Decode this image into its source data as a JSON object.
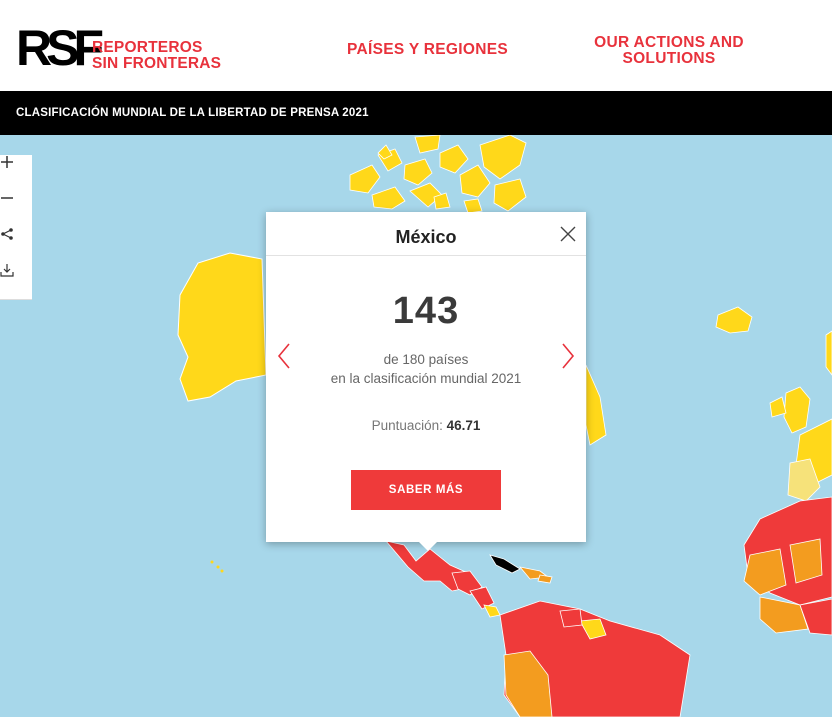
{
  "header": {
    "logo_mark": "RSF",
    "logo_line1": "REPORTEROS",
    "logo_line2": "SIN FRONTERAS",
    "nav": [
      "PAÍSES Y REGIONES",
      "OUR ACTIONS AND SOLUTIONS"
    ]
  },
  "titlebar": {
    "title": "CLASIFICACIÓN MUNDIAL DE LA LIBERTAD DE PRENSA 2021"
  },
  "controls": [
    "zoom-in-icon",
    "zoom-out-icon",
    "share-icon",
    "download-icon"
  ],
  "popup": {
    "country": "México",
    "rank": "143",
    "of_line1": "de 180 países",
    "of_line2": "en la clasificación mundial 2021",
    "score_label": "Puntuación:",
    "score_value": "46.71",
    "button": "SABER MÁS"
  },
  "colors": {
    "accent": "#e8323c",
    "ocean": "#a7d7ea",
    "good": "#ffd81a",
    "satisfactory": "#f6e27a",
    "problematic": "#f39c1f",
    "difficult": "#ef3a3a",
    "very_serious": "#000000"
  }
}
